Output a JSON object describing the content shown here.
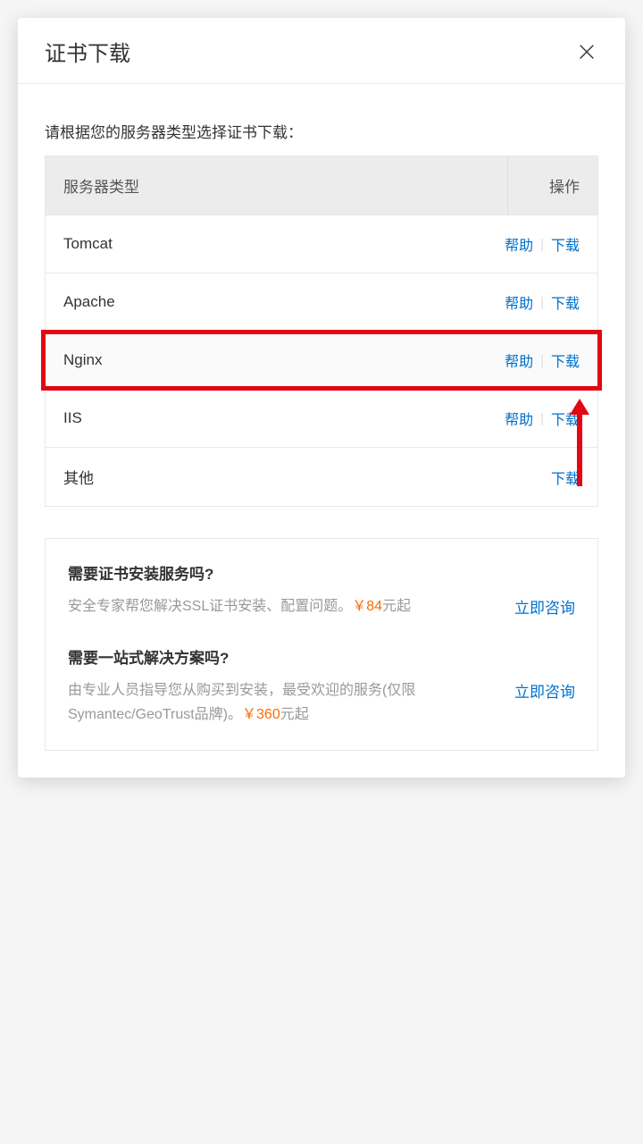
{
  "modal": {
    "title": "证书下载",
    "instruction": "请根据您的服务器类型选择证书下载：",
    "table": {
      "header_server": "服务器类型",
      "header_action": "操作",
      "help_label": "帮助",
      "download_label": "下载",
      "rows": [
        {
          "name": "Tomcat",
          "has_help": true
        },
        {
          "name": "Apache",
          "has_help": true
        },
        {
          "name": "Nginx",
          "has_help": true,
          "highlighted": true
        },
        {
          "name": "IIS",
          "has_help": true
        },
        {
          "name": "其他",
          "has_help": false
        }
      ]
    },
    "services": {
      "install": {
        "title": "需要证书安装服务吗?",
        "desc_prefix": "安全专家帮您解决SSL证书安装、配置问题。",
        "price": "￥84",
        "desc_suffix": "元起",
        "consult": "立即咨询"
      },
      "solution": {
        "title": "需要一站式解决方案吗?",
        "desc_prefix": "由专业人员指导您从购买到安装，最受欢迎的服务(仅限Symantec/GeoTrust品牌)。",
        "price": "￥360",
        "desc_suffix": "元起",
        "consult": "立即咨询"
      }
    }
  }
}
